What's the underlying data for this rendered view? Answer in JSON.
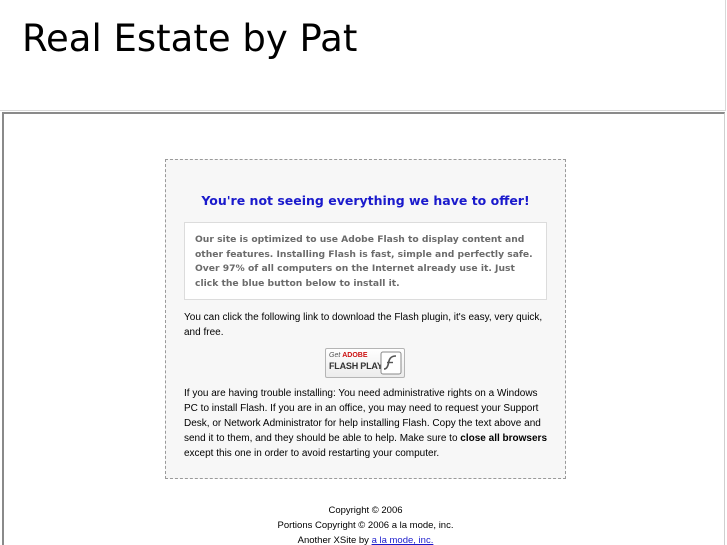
{
  "header": {
    "site_title": "Real Estate by Pat"
  },
  "notice": {
    "heading": "You're not seeing everything we have to offer!",
    "info_text": "Our site is optimized to use Adobe Flash to display content and other features. Installing Flash is fast, simple and perfectly safe. Over 97% of all computers on the Internet already use it. Just click the blue button below to install it.",
    "download_text": "You can click the following link to download the Flash plugin, it's easy, very quick, and free.",
    "flash_badge": {
      "get": "Get",
      "adobe": "ADOBE",
      "product": "FLASH PLAYER",
      "icon": "flash-logo-icon"
    },
    "trouble_text_before": "If you are having trouble installing: You need administrative rights on a Windows PC to install Flash. If you are in an office, you may need to request your Support Desk, or Network Administrator for help installing Flash. Copy the text above and send it to them, and they should be able to help. Make sure to ",
    "trouble_text_bold": "close all browsers",
    "trouble_text_after": " except this one in order to avoid restarting your computer."
  },
  "footer": {
    "copyright": "Copyright © 2006",
    "portions": "Portions Copyright © 2006 a la mode, inc.",
    "another_prefix": "Another XSite by ",
    "link_text": "a la mode, inc."
  },
  "colors": {
    "heading_blue": "#1a1acc",
    "info_text_gray": "#6b6b6b",
    "adobe_red": "#cc1111"
  }
}
